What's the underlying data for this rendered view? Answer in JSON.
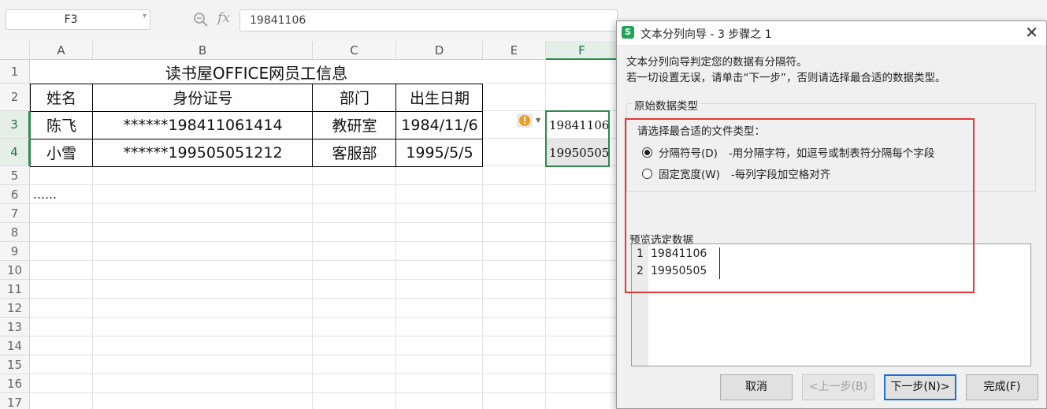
{
  "formula_bar": {
    "name_box": "F3",
    "fx_label": "fx",
    "formula_value": "19841106"
  },
  "sheet": {
    "columns": [
      "A",
      "B",
      "C",
      "D",
      "E",
      "F"
    ],
    "rows": [
      "1",
      "2",
      "3",
      "4",
      "5",
      "6",
      "7",
      "8",
      "9",
      "10",
      "11",
      "12",
      "13",
      "14",
      "15",
      "16",
      "17"
    ],
    "selected_column": "F",
    "selected_rows": [
      "3",
      "4"
    ],
    "title": "读书屋OFFICE网员工信息",
    "headers": [
      "姓名",
      "身份证号",
      "部门",
      "出生日期"
    ],
    "data_rows": [
      [
        "陈飞",
        "******198411061414",
        "教研室",
        "1984/11/6"
      ],
      [
        "小雪",
        "******199505051212",
        "客服部",
        "1995/5/5"
      ]
    ],
    "ellipsis": "……",
    "f_values": [
      "19841106",
      "19950505"
    ],
    "accent_color": "#2f8a4d"
  },
  "dialog": {
    "title": "文本分列向导 - 3 步骤之 1",
    "app_icon": "S",
    "intro_line1": "文本分列向导判定您的数据有分隔符。",
    "intro_line2": "若一切设置无误，请单击“下一步”，否则请选择最合适的数据类型。",
    "group_label": "原始数据类型",
    "choose_label": "请选择最合适的文件类型：",
    "options": [
      {
        "label": "分隔符号(D)",
        "desc": "-用分隔字符，如逗号或制表符分隔每个字段",
        "checked": true
      },
      {
        "label": "固定宽度(W)",
        "desc": "-每列字段加空格对齐",
        "checked": false
      }
    ],
    "preview_label": "预览选定数据",
    "preview_rows": [
      {
        "line": "1",
        "value": "19841106"
      },
      {
        "line": "2",
        "value": "19950505"
      }
    ],
    "buttons": {
      "cancel": "取消",
      "back": "<上一步(B)",
      "next": "下一步(N)>",
      "finish": "完成(F)"
    },
    "highlight_color": "#e53935"
  }
}
